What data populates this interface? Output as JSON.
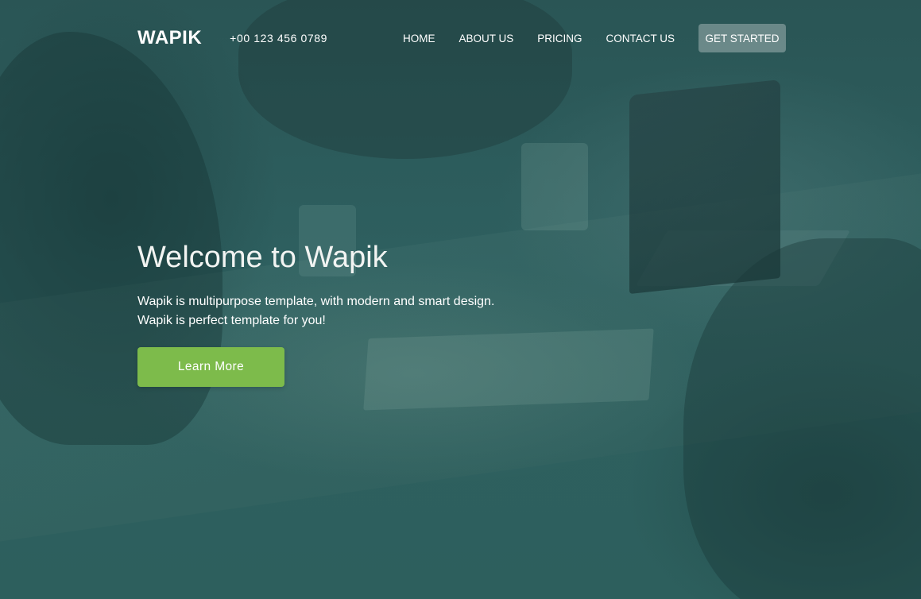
{
  "header": {
    "logo": "WAPIK",
    "phone": "+00 123 456 0789",
    "nav": [
      {
        "label": "HOME"
      },
      {
        "label": "ABOUT US"
      },
      {
        "label": "PRICING"
      },
      {
        "label": "CONTACT US"
      }
    ],
    "cta_label": "GET STARTED"
  },
  "hero": {
    "title": "Welcome to Wapik",
    "subtitle_line1": "Wapik is multipurpose template, with modern and smart design.",
    "subtitle_line2": "Wapik is perfect template for you!",
    "button_label": "Learn More"
  },
  "colors": {
    "overlay": "#2b5e5c",
    "button": "#7dbb4b",
    "cta_bg": "#9aabab"
  }
}
